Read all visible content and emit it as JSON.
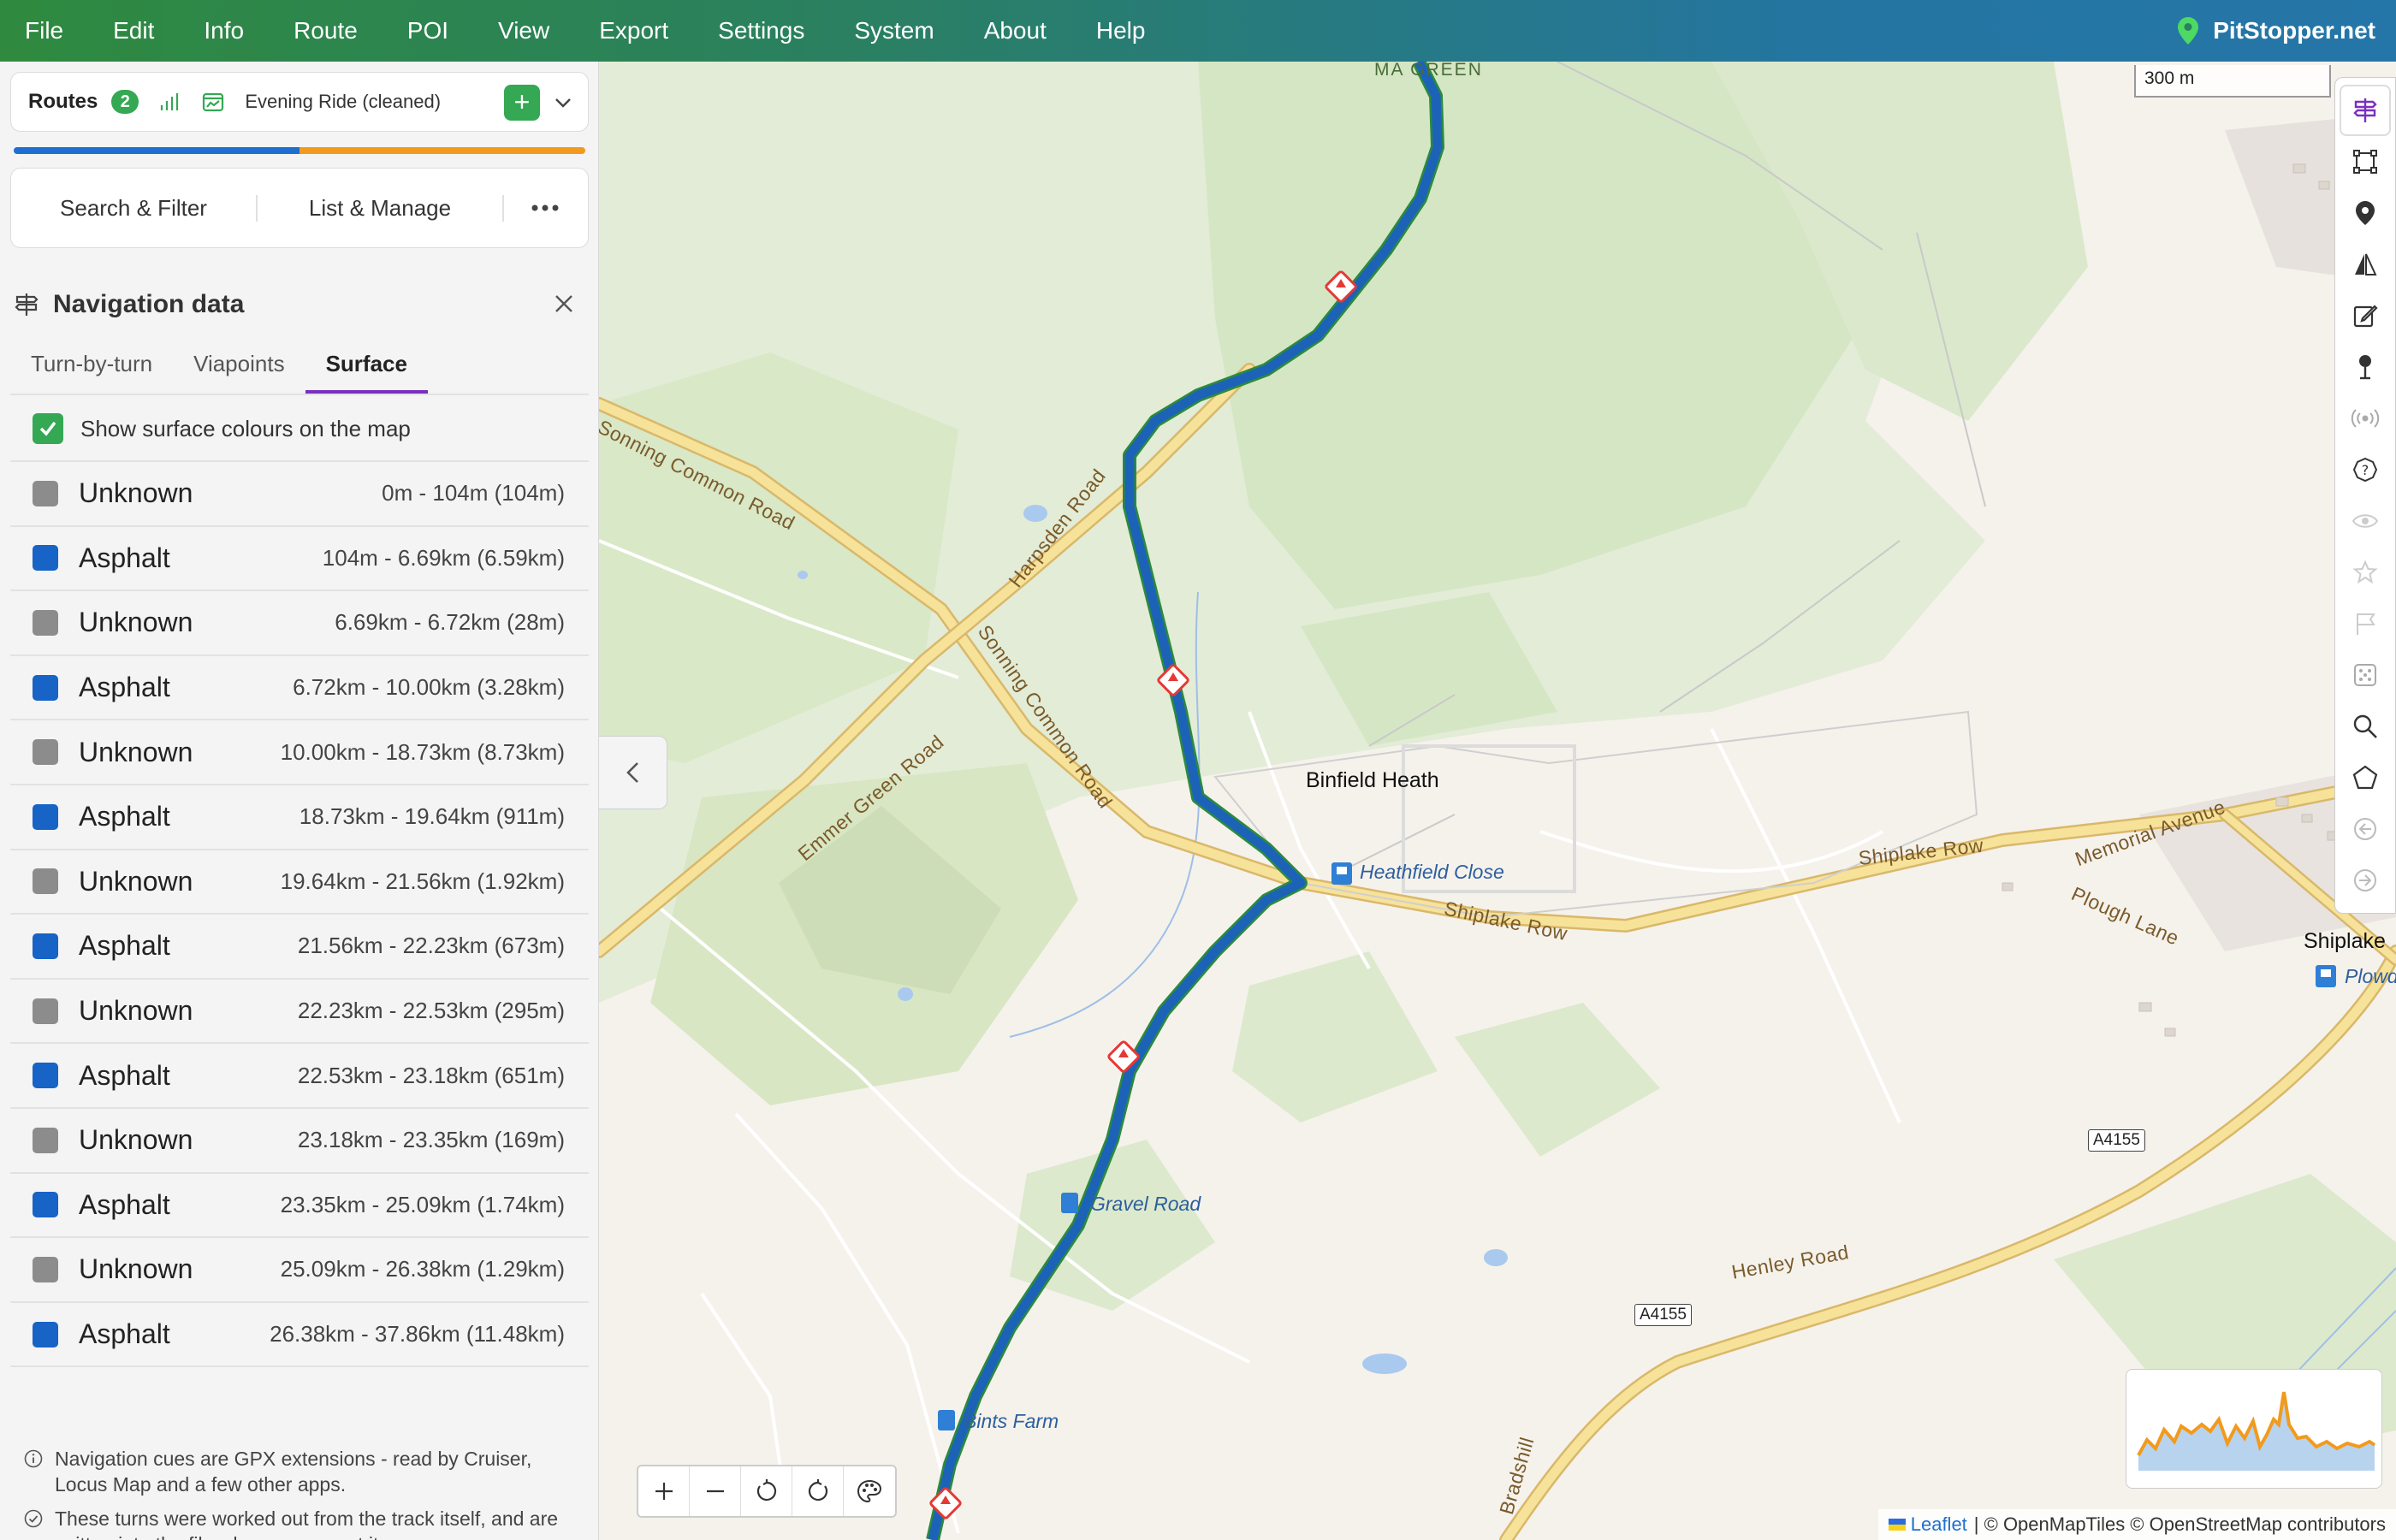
{
  "menu": {
    "items": [
      "File",
      "Edit",
      "Info",
      "Route",
      "POI",
      "View",
      "Export",
      "Settings",
      "System",
      "About",
      "Help"
    ],
    "brand": "PitStopper.net"
  },
  "routes": {
    "label": "Routes",
    "count": "2",
    "current_route": "Evening Ride (cleaned)",
    "add_label": "+"
  },
  "tools": {
    "search_filter": "Search & Filter",
    "list_manage": "List & Manage"
  },
  "nav": {
    "title": "Navigation data",
    "tabs": [
      "Turn-by-turn",
      "Viapoints",
      "Surface"
    ],
    "active_tab": "Surface",
    "show_surface_label": "Show surface colours on the map",
    "surfaces": [
      {
        "name": "Unknown",
        "range": "0m - 104m (104m)",
        "type": "unknown"
      },
      {
        "name": "Asphalt",
        "range": "104m - 6.69km (6.59km)",
        "type": "asphalt"
      },
      {
        "name": "Unknown",
        "range": "6.69km - 6.72km (28m)",
        "type": "unknown"
      },
      {
        "name": "Asphalt",
        "range": "6.72km - 10.00km (3.28km)",
        "type": "asphalt"
      },
      {
        "name": "Unknown",
        "range": "10.00km - 18.73km (8.73km)",
        "type": "unknown"
      },
      {
        "name": "Asphalt",
        "range": "18.73km - 19.64km (911m)",
        "type": "asphalt"
      },
      {
        "name": "Unknown",
        "range": "19.64km - 21.56km (1.92km)",
        "type": "unknown"
      },
      {
        "name": "Asphalt",
        "range": "21.56km - 22.23km (673m)",
        "type": "asphalt"
      },
      {
        "name": "Unknown",
        "range": "22.23km - 22.53km (295m)",
        "type": "unknown"
      },
      {
        "name": "Asphalt",
        "range": "22.53km - 23.18km (651m)",
        "type": "asphalt"
      },
      {
        "name": "Unknown",
        "range": "23.18km - 23.35km (169m)",
        "type": "unknown"
      },
      {
        "name": "Asphalt",
        "range": "23.35km - 25.09km (1.74km)",
        "type": "asphalt"
      },
      {
        "name": "Unknown",
        "range": "25.09km - 26.38km (1.29km)",
        "type": "unknown"
      },
      {
        "name": "Asphalt",
        "range": "26.38km - 37.86km (11.48km)",
        "type": "asphalt"
      }
    ],
    "notes": [
      "Navigation cues are GPX extensions - read by Cruiser, Locus Map and a few other apps.",
      "These turns were worked out from the track itself, and are written into the file when you export it."
    ]
  },
  "map": {
    "scale": "300 m",
    "labels": {
      "mapledurham_green": "MA  GREEN",
      "sonning_common_road_1": "Sonning Common Road",
      "sonning_common_road_2": "Sonning Common Road",
      "harpsden_road": "Harpsden Road",
      "emmer_green_road": "Emmer Green Road",
      "binfield_heath": "Binfield Heath",
      "heathfield_close": "Heathfield Close",
      "shiplake_row_1": "Shiplake Row",
      "shiplake_row_2": "Shiplake Row",
      "memorial_avenue": "Memorial Avenue",
      "plough_lane": "Plough Lane",
      "shiplake": "Shiplake",
      "plowden": "Plowd",
      "gravel_road": "Gravel Road",
      "bints_farm": "Bints Farm",
      "henley_road": "Henley Road",
      "a4155_1": "A4155",
      "a4155_2": "A4155",
      "bradshill": "Bradshill"
    },
    "attribution": {
      "leaflet": "Leaflet",
      "rest": "| © OpenMapTiles © OpenStreetMap contributors"
    }
  },
  "colors": {
    "menu_green": "#2f8a3f",
    "menu_blue": "#2576a8",
    "accent_green": "#34a853",
    "route_blue": "#1763c6",
    "route_orange": "#f29a1d",
    "tab_purple": "#7b2fbf"
  }
}
